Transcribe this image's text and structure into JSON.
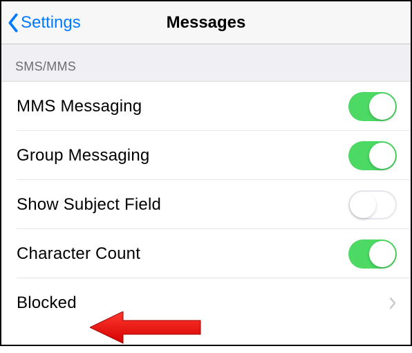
{
  "header": {
    "back_label": "Settings",
    "title": "Messages"
  },
  "section": {
    "header": "SMS/MMS"
  },
  "rows": {
    "mms": {
      "label": "MMS Messaging",
      "on": true
    },
    "group": {
      "label": "Group Messaging",
      "on": true
    },
    "subject": {
      "label": "Show Subject Field",
      "on": false
    },
    "charcount": {
      "label": "Character Count",
      "on": true
    },
    "blocked": {
      "label": "Blocked"
    }
  },
  "colors": {
    "accent": "#007aff",
    "toggle_on": "#4cd964",
    "annotation_arrow": "#ff0000"
  }
}
